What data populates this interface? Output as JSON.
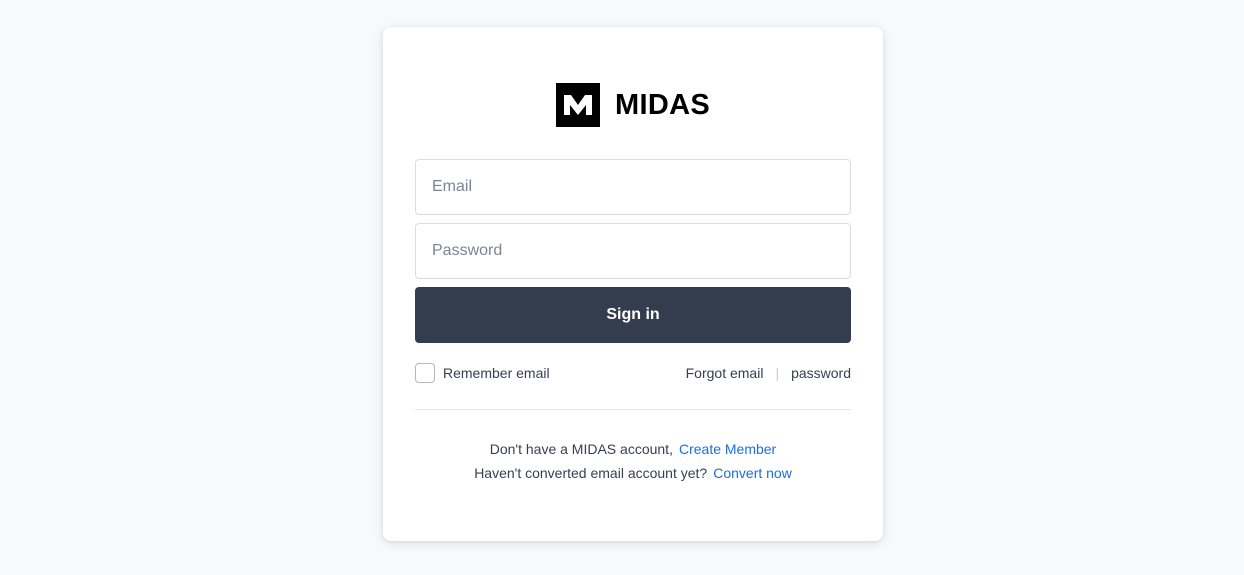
{
  "brand": {
    "name": "MIDAS",
    "logo_icon": "midas-m-logo-icon",
    "logo_color": "#000000"
  },
  "form": {
    "email_placeholder": "Email",
    "email_value": "",
    "password_placeholder": "Password",
    "password_value": "",
    "signin_label": "Sign in",
    "signin_color": "#343d4d"
  },
  "options": {
    "remember_label": "Remember email",
    "remember_checked": false,
    "forgot_email_label": "Forgot email",
    "separator": "|",
    "forgot_password_label": "password"
  },
  "footer": {
    "no_account_text": "Don't have a MIDAS account,",
    "create_member_label": "Create Member",
    "convert_text": "Haven't converted email account yet?",
    "convert_now_label": "Convert now",
    "link_color": "#1a6fe0"
  }
}
